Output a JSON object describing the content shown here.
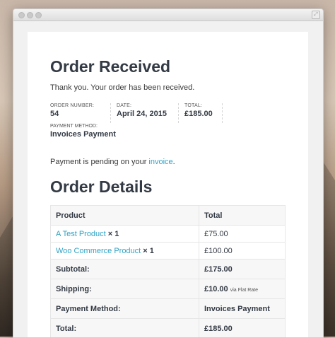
{
  "page": {
    "heading": "Order Received",
    "thank_you": "Thank you. Your order has been received."
  },
  "overview": {
    "order_number_label": "ORDER NUMBER:",
    "order_number": "54",
    "date_label": "DATE:",
    "date": "April 24, 2015",
    "total_label": "TOTAL:",
    "total": "£185.00",
    "payment_method_label": "PAYMENT METHOD:",
    "payment_method": "Invoices Payment"
  },
  "pending": {
    "prefix": "Payment is pending on your ",
    "link": "invoice",
    "suffix": "."
  },
  "details": {
    "heading": "Order Details",
    "columns": [
      "Product",
      "Total"
    ],
    "items": [
      {
        "name": "A Test Product",
        "qty": "× 1",
        "total": "£75.00"
      },
      {
        "name": "Woo Commerce Product",
        "qty": "× 1",
        "total": "£100.00"
      }
    ],
    "totals": [
      {
        "label": "Subtotal:",
        "value": "£175.00",
        "note": ""
      },
      {
        "label": "Shipping:",
        "value": "£10.00",
        "note": "via Flat Rate"
      },
      {
        "label": "Payment Method:",
        "value": "Invoices Payment",
        "note": ""
      },
      {
        "label": "Total:",
        "value": "£185.00",
        "note": ""
      }
    ]
  },
  "colors": {
    "link": "#2ea3c6",
    "heading": "#333a44"
  }
}
